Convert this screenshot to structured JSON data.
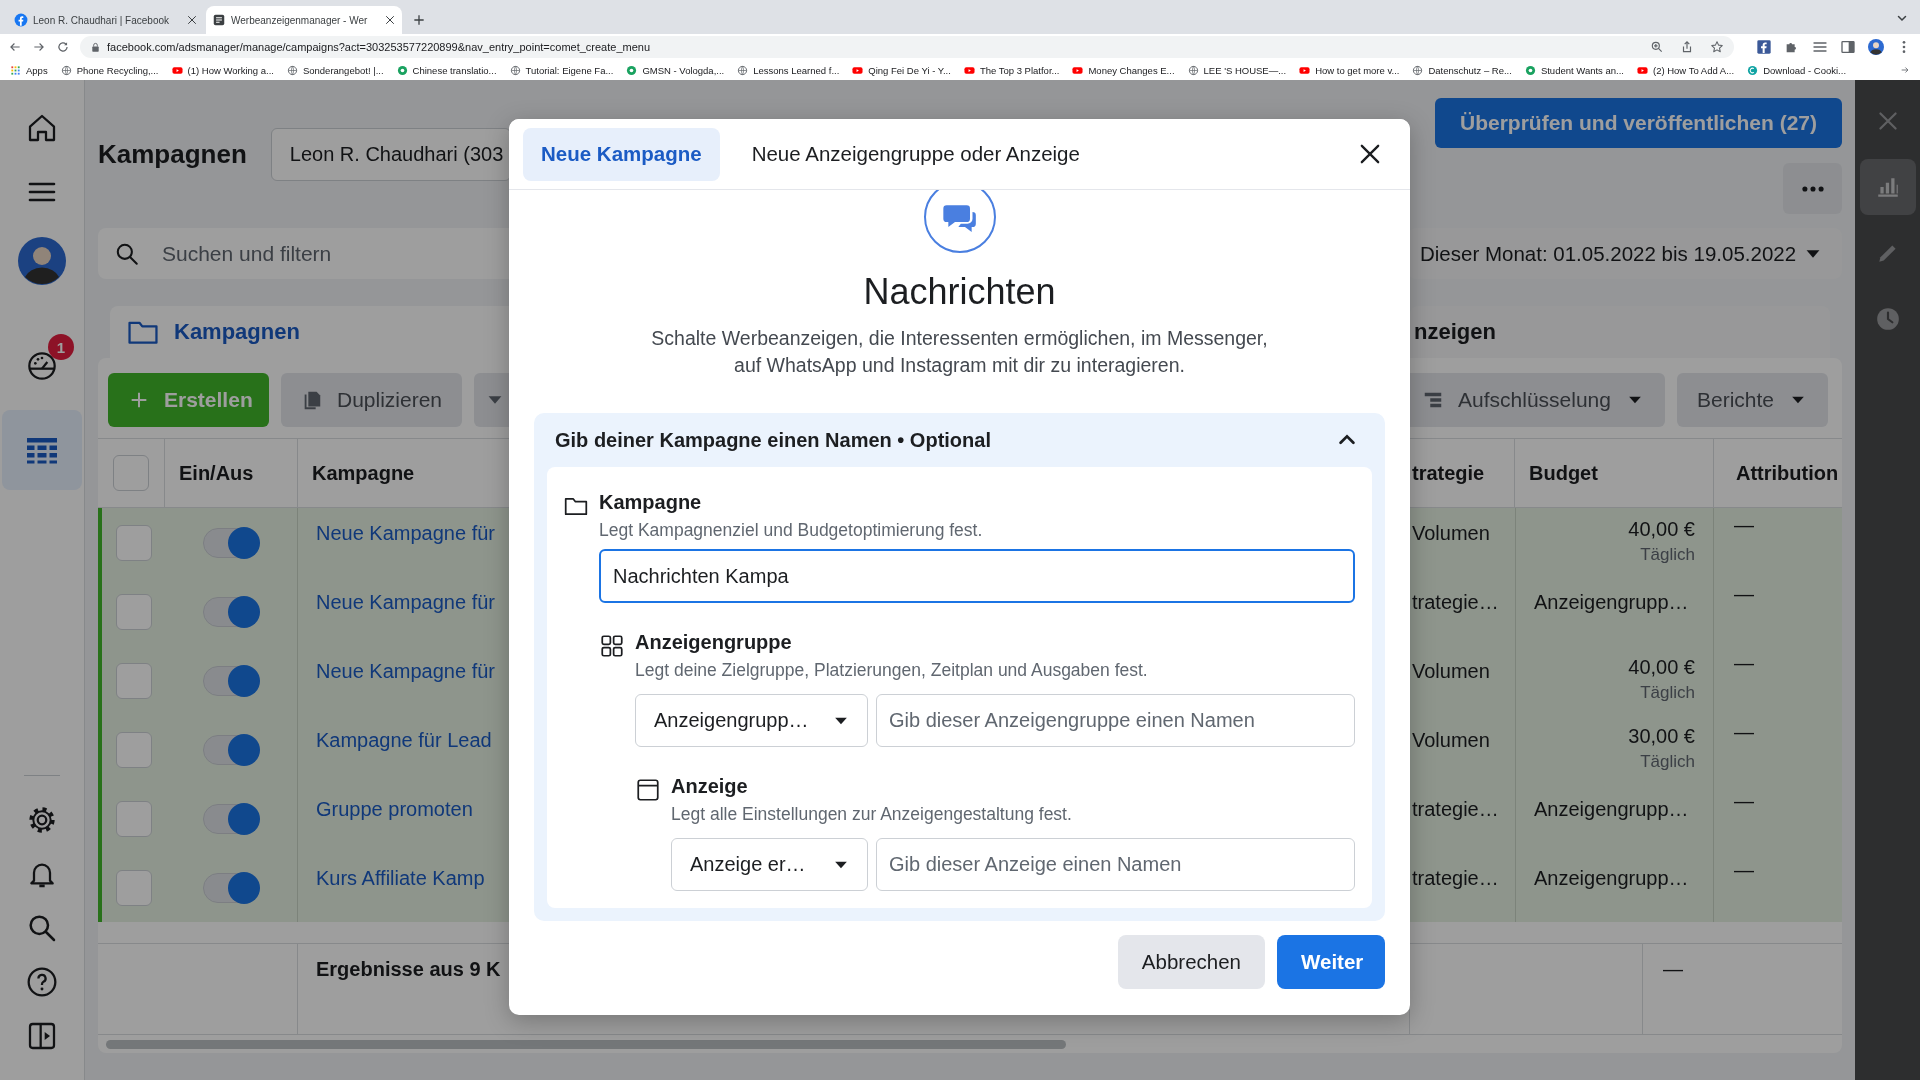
{
  "browser": {
    "tabs": [
      {
        "title": "Leon R. Chaudhari | Facebook",
        "kind": "facebook",
        "selected": false
      },
      {
        "title": "Werbeanzeigenmanager - Wer",
        "kind": "page",
        "selected": true
      }
    ],
    "url": "facebook.com/adsmanager/manage/campaigns?act=303253577220899&nav_entry_point=comet_create_menu",
    "bookmarks": [
      {
        "label": "Apps",
        "kind": "apps"
      },
      {
        "label": "Phone Recycling,...",
        "kind": "site"
      },
      {
        "label": "(1) How Working a...",
        "kind": "video"
      },
      {
        "label": "Sonderangebot! |...",
        "kind": "site"
      },
      {
        "label": "Chinese translatio...",
        "kind": "green"
      },
      {
        "label": "Tutorial: Eigene Fa...",
        "kind": "site"
      },
      {
        "label": "GMSN - Vologda,...",
        "kind": "green"
      },
      {
        "label": "Lessons Learned f...",
        "kind": "site"
      },
      {
        "label": "Qing Fei De Yi - Y...",
        "kind": "video"
      },
      {
        "label": "The Top 3 Platfor...",
        "kind": "video"
      },
      {
        "label": "Money Changes E...",
        "kind": "video"
      },
      {
        "label": "LEE 'S HOUSE—...",
        "kind": "site"
      },
      {
        "label": "How to get more v...",
        "kind": "video"
      },
      {
        "label": "Datenschutz – Re...",
        "kind": "site"
      },
      {
        "label": "Student Wants an...",
        "kind": "green"
      },
      {
        "label": "(2) How To Add A...",
        "kind": "video"
      },
      {
        "label": "Download - Cooki...",
        "kind": "teal"
      }
    ]
  },
  "nav_rail": {
    "items": [
      {
        "kind": "home",
        "selected": false
      },
      {
        "kind": "menu",
        "selected": false
      },
      {
        "kind": "avatar",
        "selected": false
      },
      {
        "kind": "gauge",
        "selected": false,
        "badge": "1"
      },
      {
        "kind": "table",
        "selected": true
      },
      {
        "kind": "settings",
        "selected": false
      },
      {
        "kind": "bell",
        "selected": false
      },
      {
        "kind": "search",
        "selected": false
      },
      {
        "kind": "help",
        "selected": false
      },
      {
        "kind": "panel",
        "selected": false
      }
    ]
  },
  "header": {
    "title": "Kampagnen",
    "account": "Leon R. Chaudhari (303",
    "publish_button": "Überprüfen und veröffentlichen (27)"
  },
  "search": {
    "placeholder": "Suchen und filtern"
  },
  "date_range": "Dieser Monat: 01.05.2022 bis 19.05.2022",
  "level_tabs": [
    {
      "label": "Kampagnen",
      "selected": true
    },
    {
      "label": "nzeigen",
      "selected": false
    }
  ],
  "toolbar": {
    "create": "Erstellen",
    "duplicate": "Duplizieren",
    "breakdown": "Aufschlüsselung",
    "reports": "Berichte"
  },
  "table": {
    "select_all_checked": false,
    "columns": [
      "Ein/Aus",
      "Kampagne",
      "trategie",
      "Budget",
      "Attribution"
    ],
    "rows": [
      {
        "checked": false,
        "on": true,
        "name": "Neue Kampagne für",
        "strategy": "Volumen",
        "budget": "40,00 €",
        "budget_note": "Täglich",
        "attribution": "—"
      },
      {
        "checked": false,
        "on": true,
        "name": "Neue Kampagne für",
        "strategy": "trategie…",
        "budget": "Anzeigengrupp…",
        "attribution": "—"
      },
      {
        "checked": false,
        "on": true,
        "name": "Neue Kampagne für",
        "strategy": "Volumen",
        "budget": "40,00 €",
        "budget_note": "Täglich",
        "attribution": "—"
      },
      {
        "checked": false,
        "on": true,
        "name": "Kampagne für Lead",
        "strategy": "Volumen",
        "budget": "30,00 €",
        "budget_note": "Täglich",
        "attribution": "—"
      },
      {
        "checked": false,
        "on": true,
        "name": "Gruppe promoten",
        "strategy": "trategie…",
        "budget": "Anzeigengrupp…",
        "attribution": "—"
      },
      {
        "checked": false,
        "on": true,
        "name": "Kurs Affiliate Kamp",
        "strategy": "trategie…",
        "budget": "Anzeigengrupp…",
        "attribution": "—"
      }
    ],
    "footer": {
      "label": "Ergebnisse aus 9 K",
      "attribution": "—"
    }
  },
  "right_rail": {
    "items": [
      {
        "kind": "close",
        "selected": false
      },
      {
        "kind": "chart",
        "selected": true
      },
      {
        "kind": "edit",
        "selected": false
      },
      {
        "kind": "history",
        "selected": false
      }
    ]
  },
  "dialog": {
    "tabs": [
      {
        "label": "Neue Kampagne",
        "selected": true
      },
      {
        "label": "Neue Anzeigengruppe oder Anzeige",
        "selected": false
      }
    ],
    "objective": {
      "title": "Nachrichten",
      "description": "Schalte Werbeanzeigen, die Interessenten ermöglichen, im Messenger, auf WhatsApp und Instagram mit dir zu interagieren."
    },
    "section": {
      "title": "Gib deiner Kampagne einen Namen • Optional",
      "expanded": true,
      "levels": [
        {
          "kind": "campaign",
          "label": "Kampagne",
          "description": "Legt Kampagnenziel und Budgetoptimierung fest.",
          "value": "Nachrichten Kampa",
          "children": [
            {
              "kind": "ad_set",
              "label": "Anzeigengruppe",
              "description": "Legt deine Zielgruppe, Platzierungen, Zeitplan und Ausgaben fest.",
              "select": "Anzeigengrupp…",
              "placeholder": "Gib dieser Anzeigengruppe einen Namen",
              "children": [
                {
                  "kind": "ad",
                  "label": "Anzeige",
                  "description": "Legt alle Einstellungen zur Anzeigengestaltung fest.",
                  "select": "Anzeige er…",
                  "placeholder": "Gib dieser Anzeige einen Namen"
                }
              ]
            }
          ]
        }
      ]
    },
    "buttons": [
      {
        "label": "Abbrechen",
        "kind": "secondary"
      },
      {
        "label": "Weiter",
        "kind": "primary"
      }
    ]
  }
}
